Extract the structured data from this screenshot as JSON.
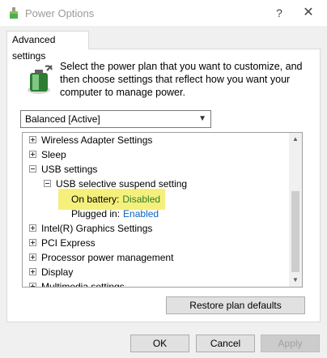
{
  "window": {
    "title": "Power Options",
    "help_symbol": "?",
    "close_symbol": "✕"
  },
  "tab": {
    "label": "Advanced settings"
  },
  "description": "Select the power plan that you want to customize, and then choose settings that reflect how you want your computer to manage power.",
  "plan_select": {
    "value": "Balanced [Active]"
  },
  "tree": {
    "items": [
      {
        "label": "Wireless Adapter Settings",
        "expanded": false
      },
      {
        "label": "Sleep",
        "expanded": false
      },
      {
        "label": "USB settings",
        "expanded": true
      },
      {
        "label": "USB selective suspend setting",
        "expanded": true
      },
      {
        "label": "On battery:",
        "value": "Disabled"
      },
      {
        "label": "Plugged in:",
        "value": "Enabled"
      },
      {
        "label": "Intel(R) Graphics Settings",
        "expanded": false
      },
      {
        "label": "PCI Express",
        "expanded": false
      },
      {
        "label": "Processor power management",
        "expanded": false
      },
      {
        "label": "Display",
        "expanded": false
      },
      {
        "label": "Multimedia settings",
        "expanded": false
      }
    ]
  },
  "buttons": {
    "restore": "Restore plan defaults",
    "ok": "OK",
    "cancel": "Cancel",
    "apply": "Apply"
  },
  "colors": {
    "highlight": "#f5f07c",
    "link_blue": "#0b62c4",
    "disabled_green": "#2f7d2a"
  },
  "icons": [
    "power-options-app-icon",
    "battery-power-icon",
    "help-icon",
    "close-icon",
    "dropdown-arrow-icon",
    "scroll-up-icon",
    "scroll-down-icon"
  ]
}
